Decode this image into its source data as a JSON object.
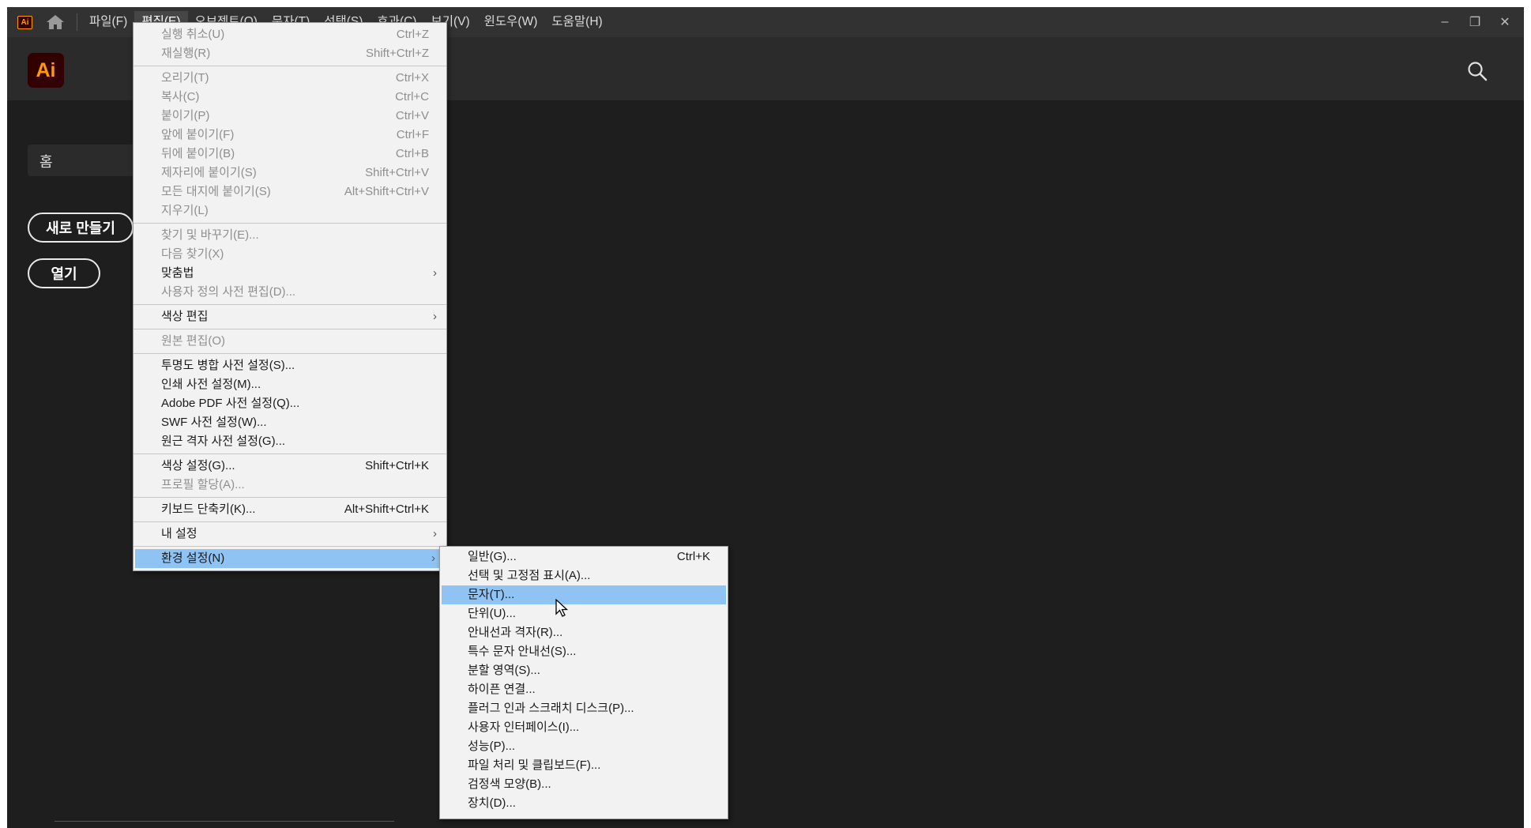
{
  "app": {
    "small_logo": "Ai",
    "logo": "Ai",
    "menubar": [
      {
        "label": "파일(F)"
      },
      {
        "label": "편집(E)",
        "active": true
      },
      {
        "label": "오브젝트(O)"
      },
      {
        "label": "문자(T)"
      },
      {
        "label": "선택(S)"
      },
      {
        "label": "효과(C)"
      },
      {
        "label": "보기(V)"
      },
      {
        "label": "윈도우(W)"
      },
      {
        "label": "도움말(H)"
      }
    ],
    "window_controls": {
      "minimize": "–",
      "restore": "❐",
      "close": "✕"
    },
    "accent_color": "#ff9a00",
    "highlight_color": "#8fc3f3"
  },
  "sidebar": {
    "home_tab": "홈",
    "new_button": "새로 만들기",
    "open_button": "열기"
  },
  "edit_menu": {
    "groups": [
      [
        {
          "label": "실행 취소(U)",
          "shortcut": "Ctrl+Z",
          "disabled": true
        },
        {
          "label": "재실행(R)",
          "shortcut": "Shift+Ctrl+Z",
          "disabled": true
        }
      ],
      [
        {
          "label": "오리기(T)",
          "shortcut": "Ctrl+X",
          "disabled": true
        },
        {
          "label": "복사(C)",
          "shortcut": "Ctrl+C",
          "disabled": true
        },
        {
          "label": "붙이기(P)",
          "shortcut": "Ctrl+V",
          "disabled": true
        },
        {
          "label": "앞에 붙이기(F)",
          "shortcut": "Ctrl+F",
          "disabled": true
        },
        {
          "label": "뒤에 붙이기(B)",
          "shortcut": "Ctrl+B",
          "disabled": true
        },
        {
          "label": "제자리에 붙이기(S)",
          "shortcut": "Shift+Ctrl+V",
          "disabled": true
        },
        {
          "label": "모든 대지에 붙이기(S)",
          "shortcut": "Alt+Shift+Ctrl+V",
          "disabled": true
        },
        {
          "label": "지우기(L)",
          "shortcut": "",
          "disabled": true
        }
      ],
      [
        {
          "label": "찾기 및 바꾸기(E)...",
          "shortcut": "",
          "disabled": true
        },
        {
          "label": "다음 찾기(X)",
          "shortcut": "",
          "disabled": true
        },
        {
          "label": "맞춤법",
          "shortcut": "",
          "disabled": false,
          "submenu": true
        },
        {
          "label": "사용자 정의 사전 편집(D)...",
          "shortcut": "",
          "disabled": true
        }
      ],
      [
        {
          "label": "색상 편집",
          "shortcut": "",
          "disabled": false,
          "submenu": true
        }
      ],
      [
        {
          "label": "원본 편집(O)",
          "shortcut": "",
          "disabled": true
        }
      ],
      [
        {
          "label": "투명도 병합 사전 설정(S)...",
          "shortcut": "",
          "disabled": false
        },
        {
          "label": "인쇄 사전 설정(M)...",
          "shortcut": "",
          "disabled": false
        },
        {
          "label": "Adobe PDF 사전 설정(Q)...",
          "shortcut": "",
          "disabled": false
        },
        {
          "label": "SWF 사전 설정(W)...",
          "shortcut": "",
          "disabled": false
        },
        {
          "label": "원근 격자 사전 설정(G)...",
          "shortcut": "",
          "disabled": false
        }
      ],
      [
        {
          "label": "색상 설정(G)...",
          "shortcut": "Shift+Ctrl+K",
          "disabled": false
        },
        {
          "label": "프로필 할당(A)...",
          "shortcut": "",
          "disabled": true
        }
      ],
      [
        {
          "label": "키보드 단축키(K)...",
          "shortcut": "Alt+Shift+Ctrl+K",
          "disabled": false
        }
      ],
      [
        {
          "label": "내 설정",
          "shortcut": "",
          "disabled": false,
          "submenu": true
        }
      ],
      [
        {
          "label": "환경 설정(N)",
          "shortcut": "",
          "disabled": false,
          "submenu": true,
          "highlighted": true
        }
      ]
    ]
  },
  "preferences_menu": [
    {
      "label": "일반(G)...",
      "shortcut": "Ctrl+K"
    },
    {
      "label": "선택 및 고정점 표시(A)...",
      "shortcut": ""
    },
    {
      "label": "문자(T)...",
      "shortcut": "",
      "highlighted": true
    },
    {
      "label": "단위(U)...",
      "shortcut": ""
    },
    {
      "label": "안내선과 격자(R)...",
      "shortcut": ""
    },
    {
      "label": "특수 문자 안내선(S)...",
      "shortcut": ""
    },
    {
      "label": "분할 영역(S)...",
      "shortcut": ""
    },
    {
      "label": "하이픈 연결...",
      "shortcut": ""
    },
    {
      "label": "플러그 인과 스크래치 디스크(P)...",
      "shortcut": ""
    },
    {
      "label": "사용자 인터페이스(I)...",
      "shortcut": ""
    },
    {
      "label": "성능(P)...",
      "shortcut": ""
    },
    {
      "label": "파일 처리 및 클립보드(F)...",
      "shortcut": ""
    },
    {
      "label": "검정색 모양(B)...",
      "shortcut": ""
    },
    {
      "label": "장치(D)...",
      "shortcut": ""
    }
  ]
}
